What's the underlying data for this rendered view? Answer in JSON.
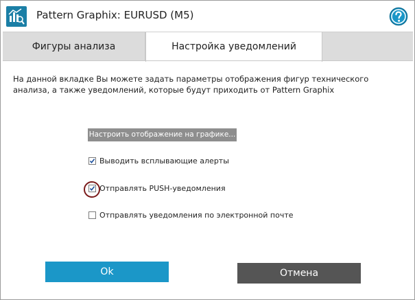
{
  "window": {
    "title": "Pattern Graphix: EURUSD (M5)",
    "icon": "app-icon",
    "help_icon": "help-icon"
  },
  "tabs": [
    {
      "label": "Фигуры анализа",
      "active": false
    },
    {
      "label": "Настройка уведомлений",
      "active": true
    }
  ],
  "main": {
    "description": "На данной вкладке Вы можете задать параметры отображения фигур технического анализа, а также уведомлений, которые будут приходить от Pattern Graphix",
    "configure_label": "Настроить отображение на графике...",
    "options": [
      {
        "label": "Выводить всплывающие алерты",
        "checked": true
      },
      {
        "label": "Отправлять PUSH-уведомления",
        "checked": true
      },
      {
        "label": "Отправлять уведомления по электронной почте",
        "checked": false
      }
    ]
  },
  "footer": {
    "ok_label": "Ok",
    "cancel_label": "Отмена"
  },
  "colors": {
    "accent": "#1b97c8",
    "cancel": "#555555",
    "highlight": "#7a1a1a"
  }
}
